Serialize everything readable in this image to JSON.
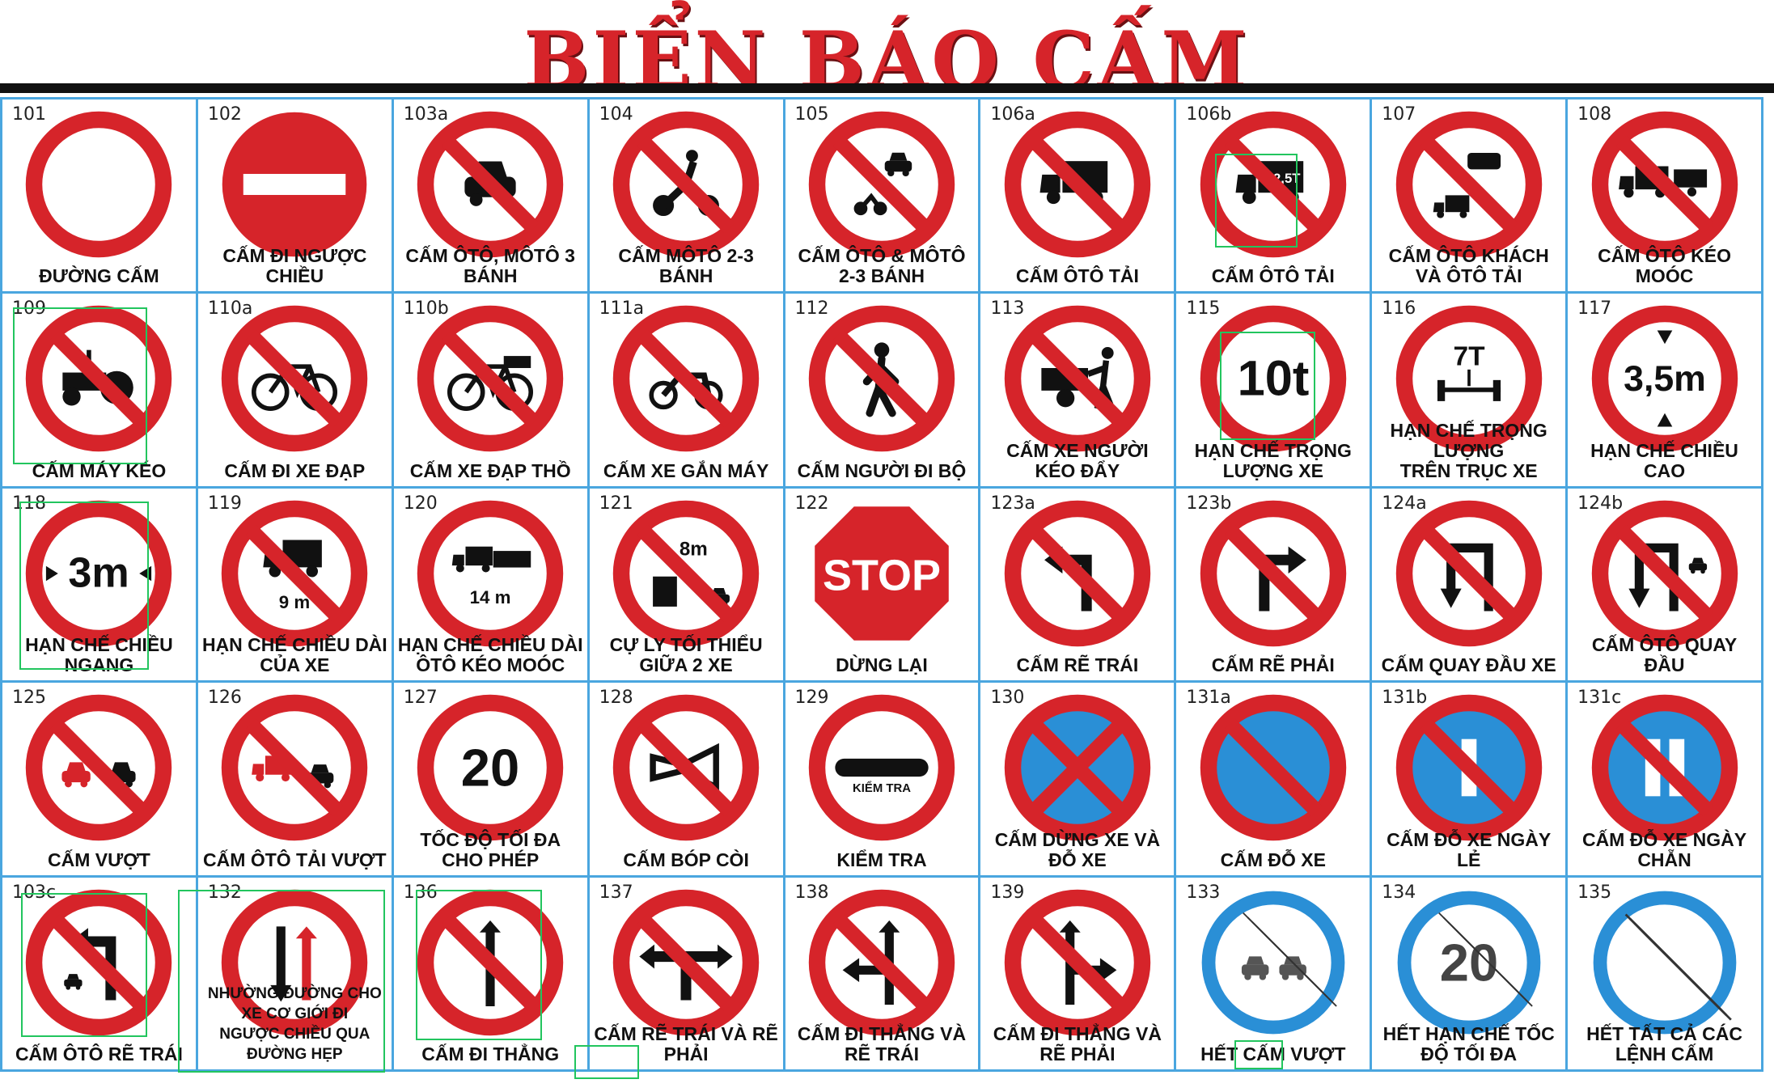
{
  "title": "BIỂN BÁO CẤM",
  "colors": {
    "red": "#d6242a",
    "blue": "#2a8fd6",
    "black": "#111111",
    "grid": "#4aa6df"
  },
  "signs": [
    {
      "num": "101",
      "caption": "ĐƯỜNG CẤM",
      "icon": "empty-circle-sign"
    },
    {
      "num": "102",
      "caption": "CẤM ĐI NGƯỢC CHIỀU",
      "icon": "no-entry-sign"
    },
    {
      "num": "103a",
      "caption": "CẤM ÔTÔ, MÔTÔ 3 BÁNH",
      "icon": "no-car-sign"
    },
    {
      "num": "104",
      "caption": "CẤM MÔTÔ 2-3 BÁNH",
      "icon": "no-motorcycle-sign"
    },
    {
      "num": "105",
      "caption": "CẤM ÔTÔ & MÔTÔ 2-3 BÁNH",
      "icon": "no-car-motorcycle-sign"
    },
    {
      "num": "106a",
      "caption": "CẤM ÔTÔ TẢI",
      "icon": "no-truck-sign"
    },
    {
      "num": "106b",
      "caption": "CẤM ÔTÔ TẢI",
      "icon": "no-truck-weight-sign",
      "label": "2,5T"
    },
    {
      "num": "107",
      "caption": "CẤM ÔTÔ KHÁCH VÀ ÔTÔ TẢI",
      "icon": "no-bus-truck-sign"
    },
    {
      "num": "108",
      "caption": "CẤM ÔTÔ KÉO MOÓC",
      "icon": "no-trailer-sign"
    },
    {
      "num": "109",
      "caption": "CẤM MÁY KÉO",
      "icon": "no-tractor-sign"
    },
    {
      "num": "110a",
      "caption": "CẤM ĐI XE ĐẠP",
      "icon": "no-bicycle-sign"
    },
    {
      "num": "110b",
      "caption": "CẤM XE ĐẠP THỒ",
      "icon": "no-cargo-bicycle-sign"
    },
    {
      "num": "111a",
      "caption": "CẤM XE GẮN MÁY",
      "icon": "no-moped-sign"
    },
    {
      "num": "112",
      "caption": "CẤM NGƯỜI ĐI BỘ",
      "icon": "no-pedestrian-sign"
    },
    {
      "num": "113",
      "caption": "CẤM XE NGƯỜI KÉO ĐẨY",
      "icon": "no-handcart-sign"
    },
    {
      "num": "115",
      "caption": "HẠN CHẾ TRỌNG LƯỢNG XE",
      "icon": "weight-limit-sign",
      "label": "10t"
    },
    {
      "num": "116",
      "caption": "HẠN CHẾ TRỌNG LƯỢNG\nTRÊN TRỤC XE",
      "icon": "axle-weight-limit-sign",
      "label": "7T"
    },
    {
      "num": "117",
      "caption": "HẠN CHẾ CHIỀU CAO",
      "icon": "height-limit-sign",
      "label": "3,5m"
    },
    {
      "num": "118",
      "caption": "HẠN CHẾ CHIỀU NGANG",
      "icon": "width-limit-sign",
      "label": "3m"
    },
    {
      "num": "119",
      "caption": "HẠN CHẾ CHIỀU DÀI CỦA XE",
      "icon": "length-limit-sign",
      "label": "9 m"
    },
    {
      "num": "120",
      "caption": "HẠN CHẾ CHIỀU DÀI\nÔTÔ KÉO MOÓC",
      "icon": "trailer-length-limit-sign",
      "label": "14 m"
    },
    {
      "num": "121",
      "caption": "CỰ LY TỐI THIỂU\nGIỮA 2 XE",
      "icon": "min-distance-sign",
      "label": "8m"
    },
    {
      "num": "122",
      "caption": "DỪNG LẠI",
      "icon": "stop-sign",
      "label": "STOP"
    },
    {
      "num": "123a",
      "caption": "CẤM RẼ TRÁI",
      "icon": "no-left-turn-sign"
    },
    {
      "num": "123b",
      "caption": "CẤM RẼ PHẢI",
      "icon": "no-right-turn-sign"
    },
    {
      "num": "124a",
      "caption": "CẤM QUAY ĐẦU XE",
      "icon": "no-u-turn-sign"
    },
    {
      "num": "124b",
      "caption": "CẤM ÔTÔ QUAY ĐẦU",
      "icon": "no-car-u-turn-sign"
    },
    {
      "num": "125",
      "caption": "CẤM VƯỢT",
      "icon": "no-overtaking-sign"
    },
    {
      "num": "126",
      "caption": "CẤM ÔTÔ TẢI VƯỢT",
      "icon": "no-truck-overtaking-sign"
    },
    {
      "num": "127",
      "caption": "TỐC ĐỘ TỐI ĐA\nCHO PHÉP",
      "icon": "speed-limit-sign",
      "label": "20"
    },
    {
      "num": "128",
      "caption": "CẤM BÓP CÒI",
      "icon": "no-horn-sign"
    },
    {
      "num": "129",
      "caption": "KIỂM TRA",
      "icon": "checkpoint-sign",
      "label": "KIỂM TRA"
    },
    {
      "num": "130",
      "caption": "CẤM DỪNG XE VÀ ĐỖ XE",
      "icon": "no-stopping-sign"
    },
    {
      "num": "131a",
      "caption": "CẤM ĐỖ XE",
      "icon": "no-parking-sign"
    },
    {
      "num": "131b",
      "caption": "CẤM ĐỖ XE NGÀY LẺ",
      "icon": "no-parking-odd-days-sign"
    },
    {
      "num": "131c",
      "caption": "CẤM ĐỖ XE NGÀY CHẴN",
      "icon": "no-parking-even-days-sign"
    },
    {
      "num": "103c",
      "caption": "CẤM ÔTÔ RẼ TRÁI",
      "icon": "no-car-left-turn-sign"
    },
    {
      "num": "132",
      "caption": "NHƯỜNG ĐƯỜNG CHO XE CƠ GIỚI ĐI\nNGƯỢC CHIỀU QUA ĐƯỜNG HẸP",
      "icon": "give-way-oncoming-sign",
      "small": true
    },
    {
      "num": "136",
      "caption": "CẤM ĐI THẲNG",
      "icon": "no-straight-sign"
    },
    {
      "num": "137",
      "caption": "CẤM RẼ TRÁI VÀ RẼ PHẢI",
      "icon": "no-left-right-turn-sign"
    },
    {
      "num": "138",
      "caption": "CẤM ĐI THẲNG VÀ RẼ TRÁI",
      "icon": "no-straight-left-sign"
    },
    {
      "num": "139",
      "caption": "CẤM ĐI THẲNG VÀ RẼ PHẢI",
      "icon": "no-straight-right-sign"
    },
    {
      "num": "133",
      "caption": "HẾT CẤM VƯỢT",
      "icon": "end-no-overtaking-sign"
    },
    {
      "num": "134",
      "caption": "HẾT HẠN CHẾ TỐC\nĐỘ TỐI ĐA",
      "icon": "end-speed-limit-sign",
      "label": "20"
    },
    {
      "num": "135",
      "caption": "HẾT TẤT CẢ CÁC LỆNH CẤM",
      "icon": "end-all-restrictions-sign"
    }
  ]
}
